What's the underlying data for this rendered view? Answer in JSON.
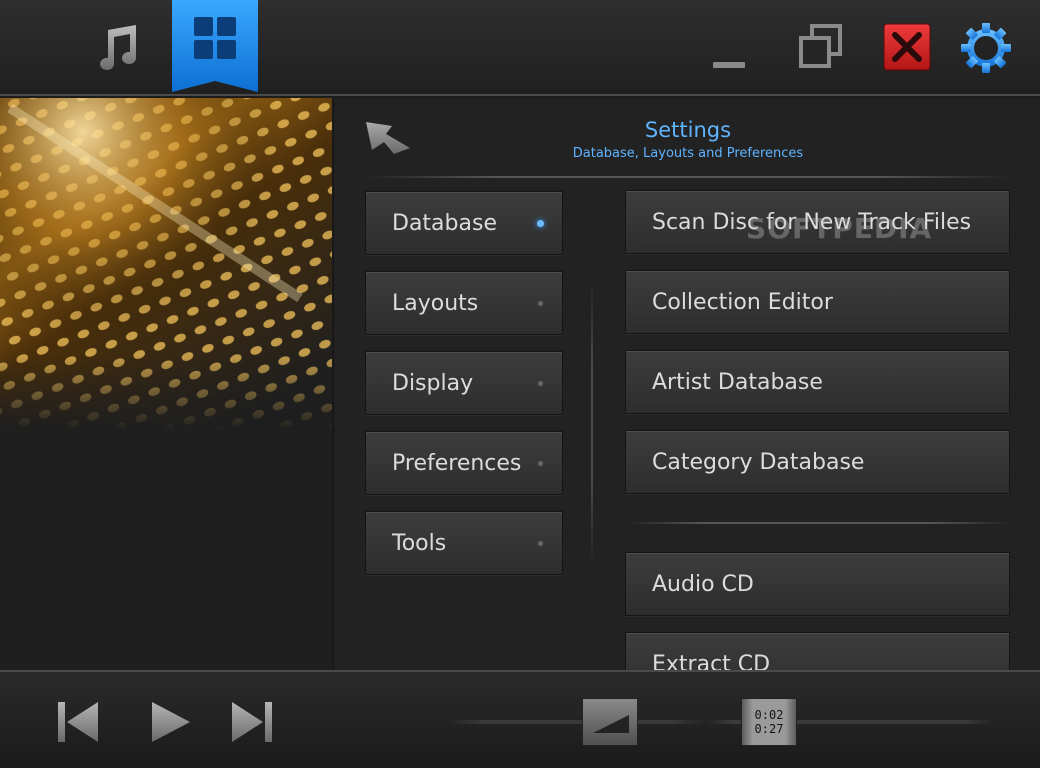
{
  "topbar": {
    "icons": [
      "music-note-icon",
      "layouts-grid-icon",
      "minimize-icon",
      "restore-icon",
      "close-icon",
      "gear-icon"
    ],
    "accent": "#1e8cf0",
    "close_color": "#d92323"
  },
  "header": {
    "title": "Settings",
    "subtitle": "Database, Layouts and Preferences"
  },
  "categories": [
    {
      "label": "Database",
      "active": true
    },
    {
      "label": "Layouts",
      "active": false
    },
    {
      "label": "Display",
      "active": false
    },
    {
      "label": "Preferences",
      "active": false
    },
    {
      "label": "Tools",
      "active": false
    }
  ],
  "actions": [
    {
      "label": "Scan Disc for New Track Files"
    },
    {
      "label": "Collection Editor"
    },
    {
      "label": "Artist Database"
    },
    {
      "label": "Category Database"
    },
    {
      "label": "Audio CD"
    },
    {
      "label": "Extract CD"
    }
  ],
  "watermark": "SOFTPEDIA",
  "transport": {
    "elapsed": "0:02",
    "total": "0:27"
  }
}
